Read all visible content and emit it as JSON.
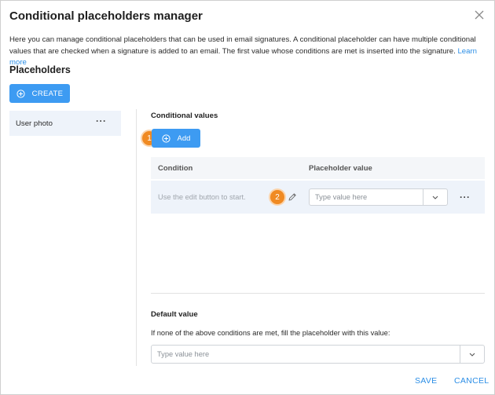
{
  "dialog": {
    "title": "Conditional placeholders manager",
    "description": "Here you can manage conditional placeholders that can be used in email signatures. A conditional placeholder can have multiple conditional values that are checked when a signature is added to an email. The first value whose conditions are met is inserted into the signature.",
    "learn_more": "Learn more",
    "close_icon": "close-icon"
  },
  "placeholders": {
    "title": "Placeholders",
    "create_label": "CREATE",
    "items": [
      {
        "label": "User photo"
      }
    ]
  },
  "conditional_values": {
    "title": "Conditional values",
    "add_label": "Add",
    "columns": {
      "condition": "Condition",
      "placeholder_value": "Placeholder value"
    },
    "rows": [
      {
        "condition_hint": "Use the edit button to start.",
        "value_placeholder": "Type value here"
      }
    ],
    "step_badges": [
      "1",
      "2"
    ]
  },
  "default_value": {
    "title": "Default value",
    "description": "If none of the above conditions are met, fill the placeholder with this value:",
    "placeholder": "Type value here"
  },
  "footer": {
    "save_label": "SAVE",
    "cancel_label": "CANCEL"
  },
  "colors": {
    "accent": "#3d9bf2",
    "link": "#2b8ee6",
    "badge": "#f08a23",
    "row_highlight": "#eef3fa"
  }
}
